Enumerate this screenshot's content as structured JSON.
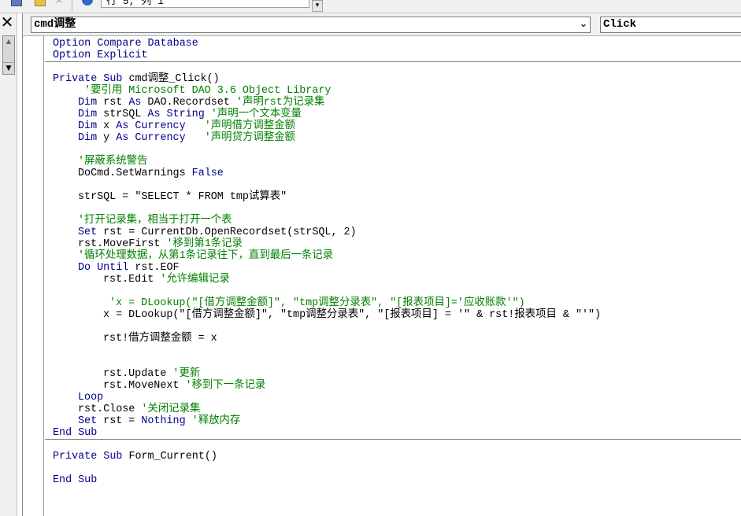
{
  "toolbar": {
    "position_text": "行 5, 列 1",
    "dropdown_symbol": "▾",
    "close_symbol": "×"
  },
  "left_panel": {
    "close_symbol": "✕",
    "scroll_up_symbol": "▲",
    "scroll_down_symbol": "▼"
  },
  "combo": {
    "object_value": "cmd调整",
    "object_arrow": "⌄",
    "procedure_value": "Click"
  },
  "code": {
    "l1": {
      "k": "Option Compare Database"
    },
    "l2": {
      "k": "Option Explicit"
    },
    "l4": {
      "k": "Private Sub ",
      "t": "cmd调整_Click()"
    },
    "l5": {
      "c": "'要引用 Microsoft DAO 3.6 Object Library"
    },
    "l6": {
      "k": "Dim ",
      "t": "rst ",
      "k2": "As ",
      "t2": "DAO.Recordset ",
      "c": "'声明rst为记录集"
    },
    "l7": {
      "k": "Dim ",
      "t": "strSQL ",
      "k2": "As String ",
      "c": "'声明一个文本变量"
    },
    "l8": {
      "k": "Dim ",
      "t": "x ",
      "k2": "As Currency",
      "t2": "   ",
      "c": "'声明借方调整金额"
    },
    "l9": {
      "k": "Dim ",
      "t": "y ",
      "k2": "As Currency",
      "t2": "   ",
      "c": "'声明贷方调整金额"
    },
    "l11": {
      "c": "'屏蔽系统警告"
    },
    "l12": {
      "t": "DoCmd.SetWarnings ",
      "k": "False"
    },
    "l14": {
      "t": "strSQL = \"SELECT * FROM tmp试算表\""
    },
    "l16": {
      "c": "'打开记录集，相当于打开一个表"
    },
    "l17": {
      "k": "Set ",
      "t": "rst = CurrentDb.OpenRecordset(strSQL, 2)"
    },
    "l18": {
      "t": "rst.MoveFirst ",
      "c": "'移到第1条记录"
    },
    "l19": {
      "c": "'循环处理数据，从第1条记录往下，直到最后一条记录"
    },
    "l20": {
      "k": "Do Until ",
      "t": "rst.EOF"
    },
    "l21": {
      "t": "rst.Edit ",
      "c": "'允许编辑记录"
    },
    "l23": {
      "c": "'x = DLookup(\"[借方调整金额]\", \"tmp调整分录表\", \"[报表项目]='应收账款'\")"
    },
    "l24": {
      "t": "x = DLookup(\"[借方调整金额]\", \"tmp调整分录表\", \"[报表项目] = '\" & rst!报表项目 & \"'\")"
    },
    "l26": {
      "t": "rst!借方调整金额 = x"
    },
    "l30": {
      "t": "rst.Update ",
      "c": "'更新"
    },
    "l31": {
      "t": "rst.MoveNext ",
      "c": "'移到下一条记录"
    },
    "l32": {
      "k": "Loop"
    },
    "l33": {
      "t": "rst.Close ",
      "c": "'关闭记录集"
    },
    "l34": {
      "k": "Set ",
      "t": "rst = ",
      "k2": "Nothing ",
      "c": "'释放内存"
    },
    "l35": {
      "k": "End Sub"
    },
    "l37": {
      "k": "Private Sub ",
      "t": "Form_Current()"
    },
    "l39": {
      "k": "End Sub"
    }
  },
  "colors": {
    "keyword": "#00008b",
    "comment": "#008000",
    "text": "#000000"
  }
}
